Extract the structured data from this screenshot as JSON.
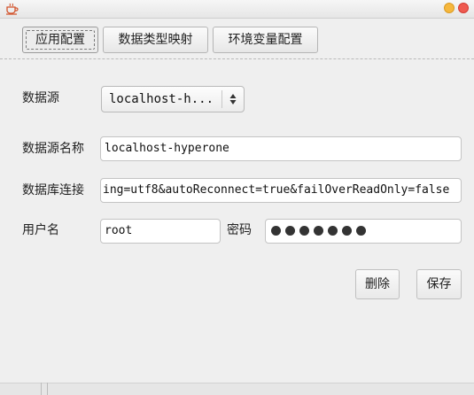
{
  "window": {
    "icon": "coffee-cup-icon"
  },
  "tabs": [
    {
      "label": "应用配置",
      "active": true
    },
    {
      "label": "数据类型映射",
      "active": false
    },
    {
      "label": "环境变量配置",
      "active": false
    }
  ],
  "form": {
    "datasource": {
      "label": "数据源",
      "selected": "localhost-h..."
    },
    "datasource_name": {
      "label": "数据源名称",
      "value": "localhost-hyperone"
    },
    "db_connection": {
      "label": "数据库连接",
      "value": "ing=utf8&autoReconnect=true&failOverReadOnly=false"
    },
    "username": {
      "label": "用户名",
      "value": "root"
    },
    "password": {
      "label": "密码",
      "masked_length": 7
    }
  },
  "actions": {
    "delete_label": "删除",
    "save_label": "保存"
  }
}
